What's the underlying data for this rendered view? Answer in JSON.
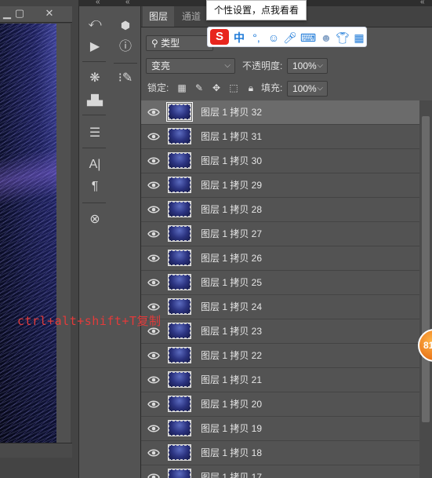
{
  "tooltip": {
    "text": "个性设置，点我看看"
  },
  "ime": {
    "logo": "S",
    "mode": "中",
    "punct": "°,",
    "icons": [
      "smile-icon",
      "mic-icon",
      "keyboard-icon",
      "user-icon",
      "shirt-icon",
      "grid-icon"
    ]
  },
  "tabs": [
    {
      "label": "图层",
      "active": true
    },
    {
      "label": "通道",
      "active": false
    }
  ],
  "filter": {
    "kind_label": "类型"
  },
  "blend": {
    "mode": "变亮",
    "opacity_label": "不透明度:",
    "opacity_value": "100%"
  },
  "lock": {
    "label": "锁定:",
    "fill_label": "填充:",
    "fill_value": "100%"
  },
  "layers": [
    {
      "name": "图层 1 拷贝 32",
      "selected": true
    },
    {
      "name": "图层 1 拷贝 31"
    },
    {
      "name": "图层 1 拷贝 30"
    },
    {
      "name": "图层 1 拷贝 29"
    },
    {
      "name": "图层 1 拷贝 28"
    },
    {
      "name": "图层 1 拷贝 27"
    },
    {
      "name": "图层 1 拷贝 26"
    },
    {
      "name": "图层 1 拷贝 25"
    },
    {
      "name": "图层 1 拷贝 24"
    },
    {
      "name": "图层 1 拷贝 23"
    },
    {
      "name": "图层 1 拷贝 22"
    },
    {
      "name": "图层 1 拷贝 21"
    },
    {
      "name": "图层 1 拷贝 20"
    },
    {
      "name": "图层 1 拷贝 19"
    },
    {
      "name": "图层 1 拷贝 18"
    },
    {
      "name": "图层 1 拷贝 17"
    }
  ],
  "overlay": {
    "text": "ctrl+alt+shift+T复制"
  },
  "badge": {
    "text": "81"
  },
  "colors": {
    "annotation": "#e23b3b",
    "panel": "#535353",
    "selected_row": "#6b6b6b"
  }
}
